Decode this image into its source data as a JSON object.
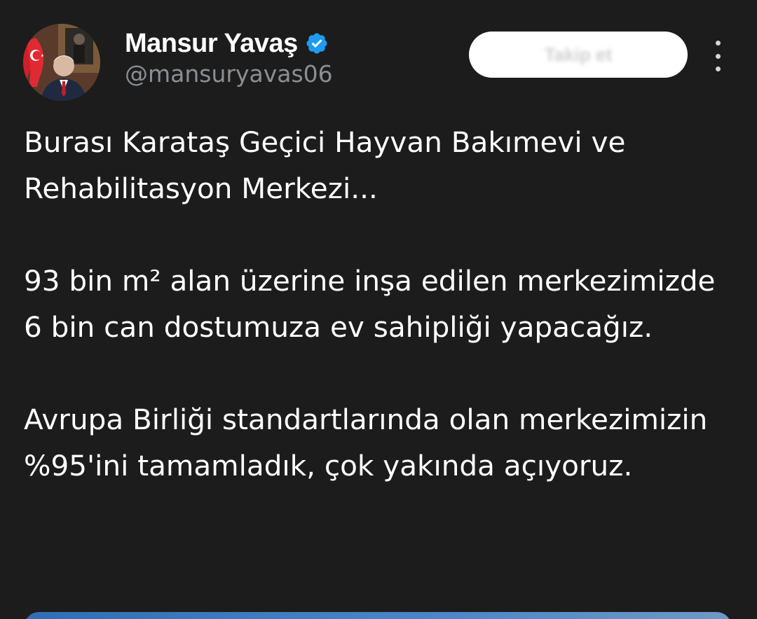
{
  "author": {
    "display_name": "Mansur Yavaş",
    "handle": "@mansuryavas06",
    "verified": true,
    "avatar_icon": "profile-photo"
  },
  "actions": {
    "follow_label": "Takip et",
    "more_icon": "more-vertical-icon"
  },
  "tweet": {
    "paragraph_1": "Burası Karataş Geçici Hayvan Bakımevi ve Rehabilitasyon Merkezi...",
    "paragraph_2": "93 bin m² alan üzerine inşa edilen merkezimizde 6 bin can dostumuza ev sahipliği yapacağız.",
    "paragraph_3": "Avrupa Birliği standartlarında olan merkezimizin %95'ini tamamladık, çok yakında açıyoruz."
  },
  "colors": {
    "background": "#1c1c1c",
    "text_primary": "#ffffff",
    "text_secondary": "#8b8e92",
    "verified_badge": "#1d9bf0",
    "follow_button_bg": "#ffffff"
  }
}
